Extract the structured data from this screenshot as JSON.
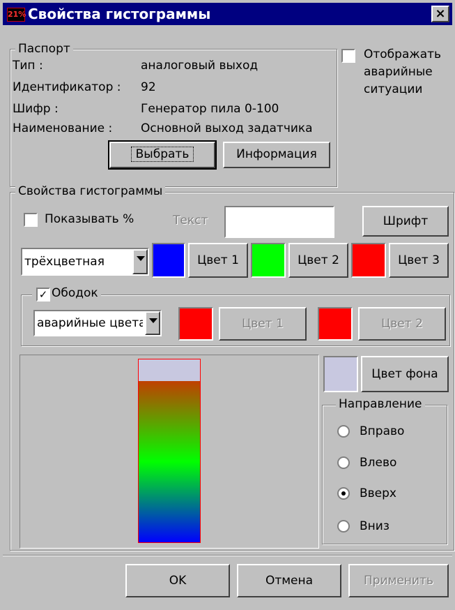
{
  "window": {
    "title": "Свойства гистограммы",
    "icon_text": "21%",
    "close_glyph": "×"
  },
  "passport": {
    "group_title": "Паспорт",
    "type_label": "Тип :",
    "type_value": "аналоговый выход",
    "id_label": "Идентификатор :",
    "id_value": "92",
    "cipher_label": "Шифр :",
    "cipher_value": "Генератор пила 0-100",
    "name_label": "Наименование :",
    "name_value": "Основной выход задатчика",
    "select_button": "Выбрать",
    "info_button": "Информация"
  },
  "alarms": {
    "label": "Отображать аварийные ситуации",
    "checked": false
  },
  "histogram": {
    "group_title": "Свойства гистограммы",
    "show_percent_label": "Показывать %",
    "show_percent_checked": false,
    "text_label": "Текст",
    "text_value": "",
    "font_button": "Шрифт",
    "color_mode": "трёхцветная",
    "color1": "#0000ff",
    "color2": "#00ff00",
    "color3": "#ff0000",
    "color1_button": "Цвет 1",
    "color2_button": "Цвет 2",
    "color3_button": "Цвет 3"
  },
  "border": {
    "group_title": "Ободок",
    "checked": true,
    "mode": "аварийные цвета",
    "color1": "#ff0000",
    "color2": "#ff0000",
    "color1_button": "Цвет 1",
    "color2_button": "Цвет 2"
  },
  "preview": {
    "bg_color": "#c8c8e0",
    "bg_button": "Цвет фона",
    "fill_fraction": 0.88,
    "gradient": [
      "#c04000",
      "#00ff00",
      "#0000ff"
    ]
  },
  "direction": {
    "group_title": "Направление",
    "options": [
      "Вправо",
      "Влево",
      "Вверх",
      "Вниз"
    ],
    "selected": "Вверх"
  },
  "footer": {
    "ok": "OK",
    "cancel": "Отмена",
    "apply": "Применить"
  }
}
